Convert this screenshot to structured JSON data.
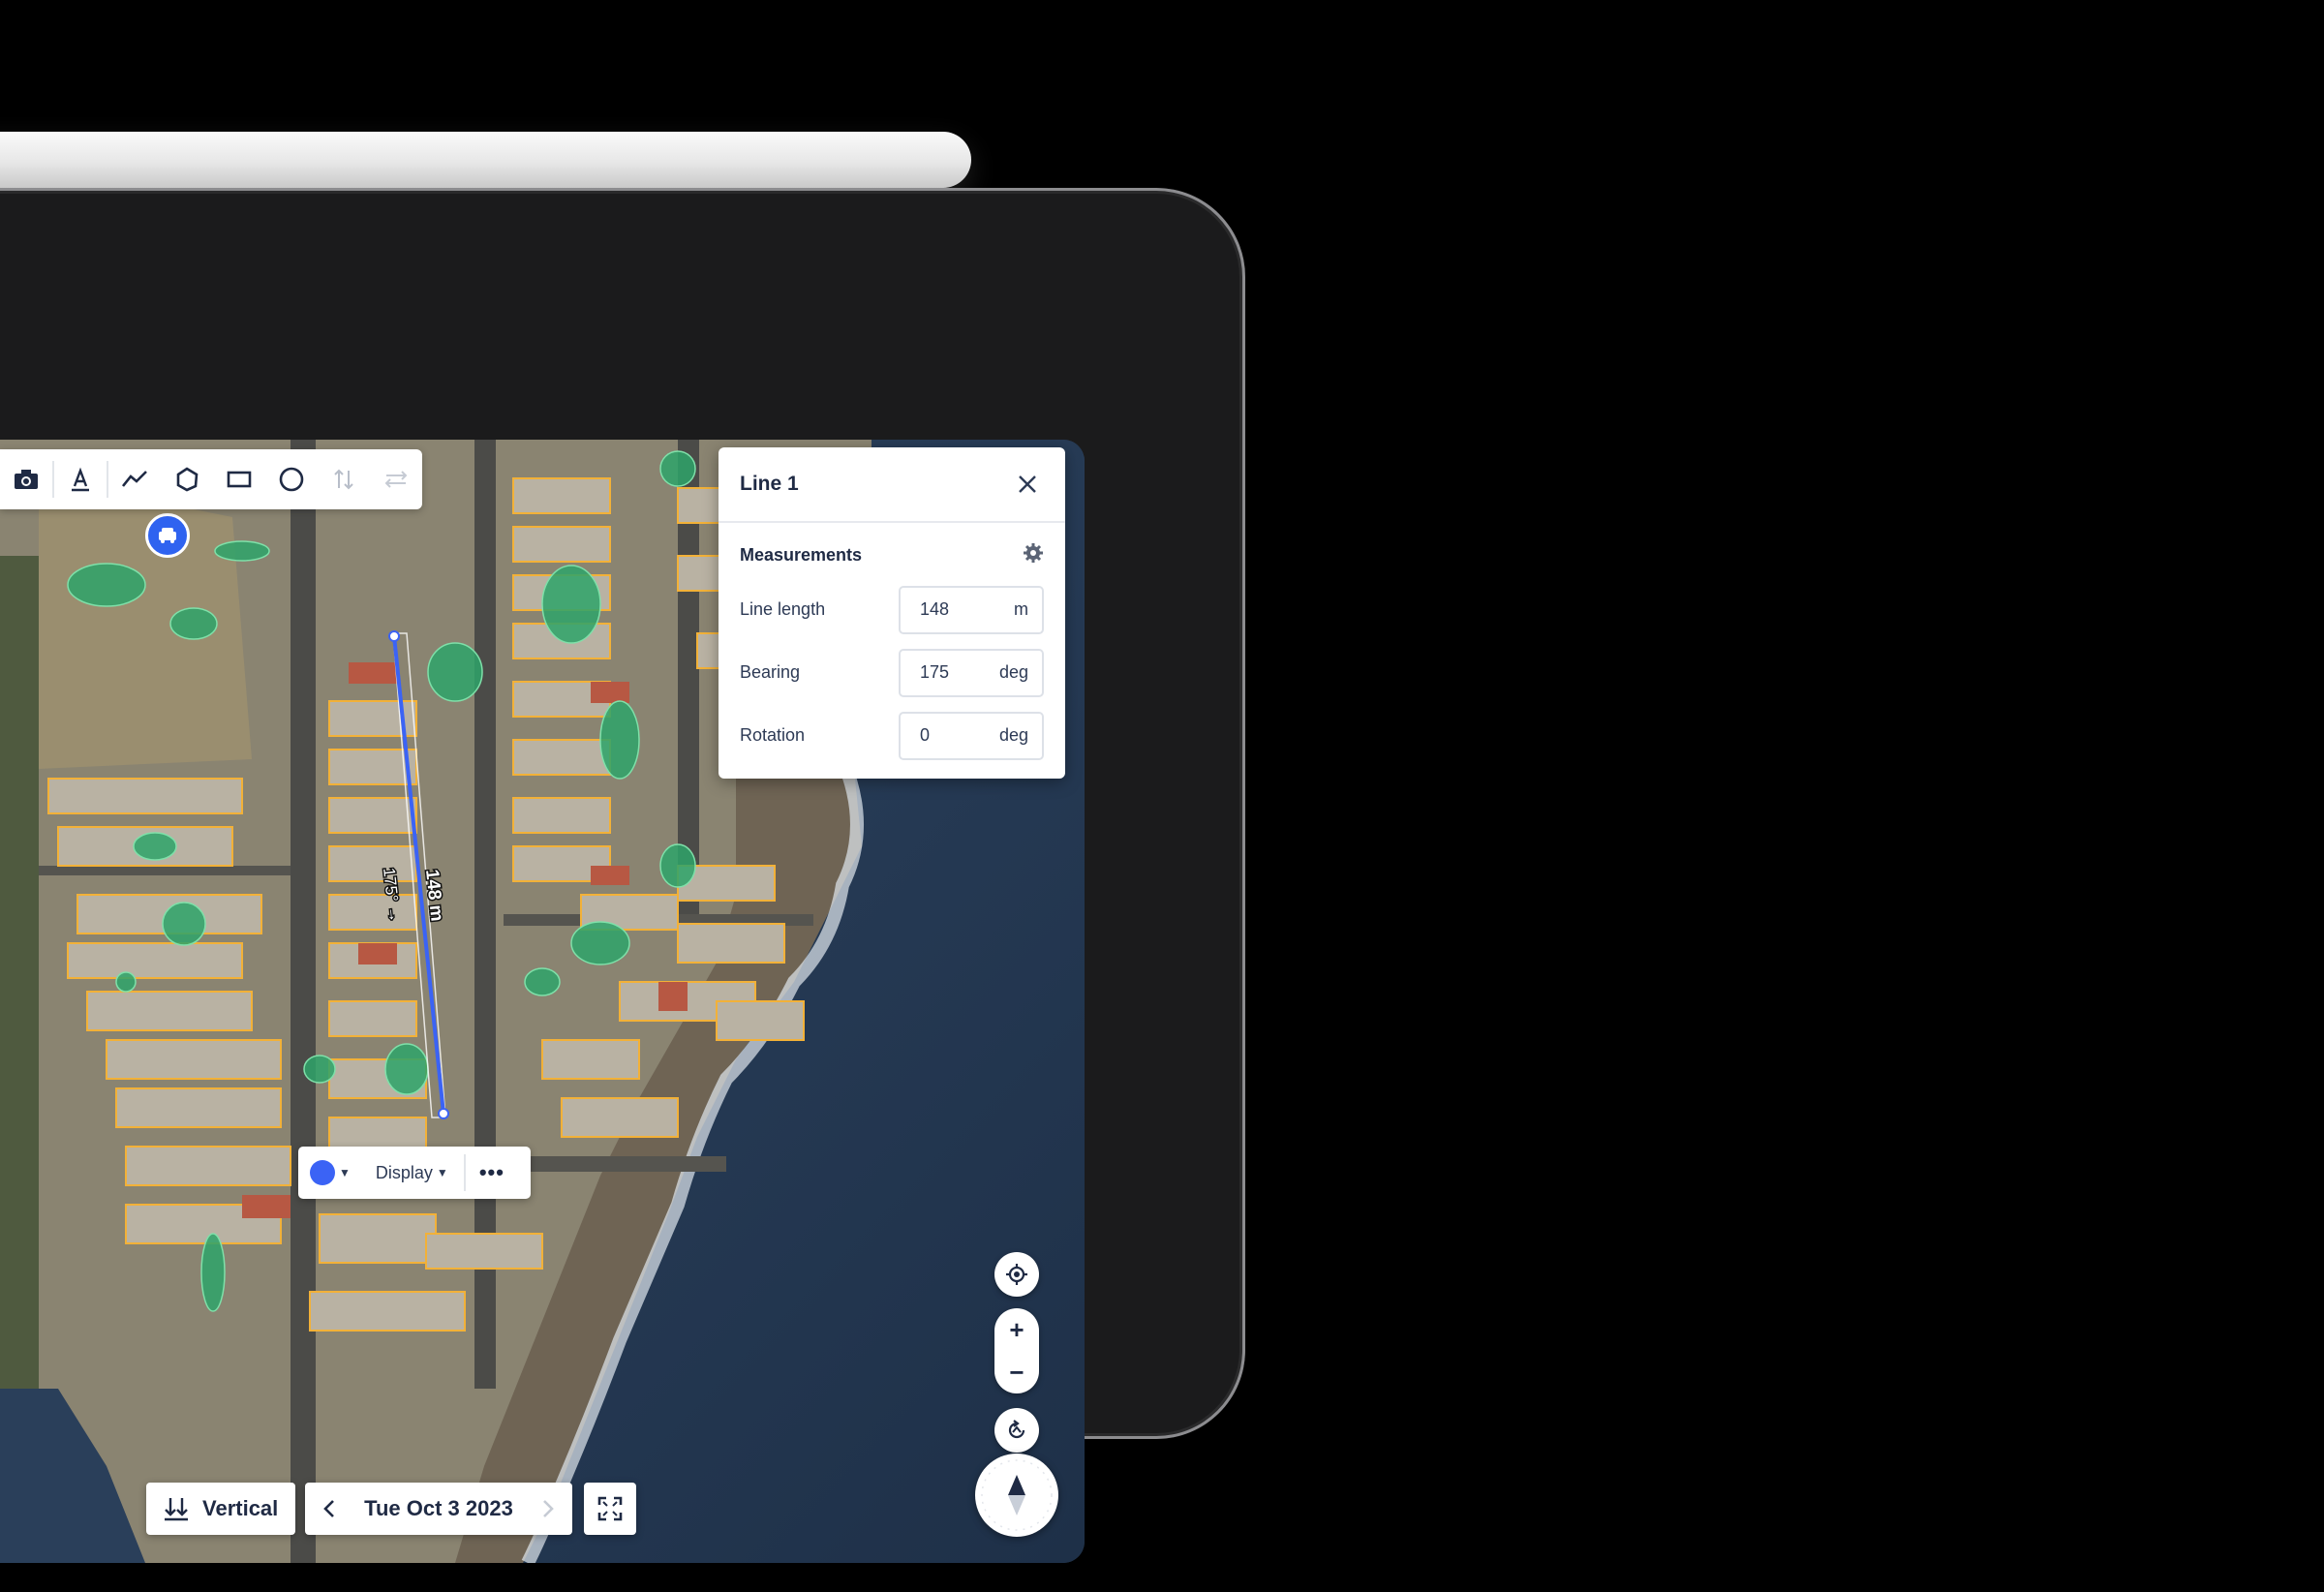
{
  "toolbar": {
    "tools": [
      "camera-icon",
      "text-icon",
      "line-icon",
      "polygon-icon",
      "rectangle-icon",
      "circle-icon",
      "vertical-measure-icon",
      "swap-icon"
    ]
  },
  "panel": {
    "title": "Line 1",
    "section_title": "Measurements",
    "fields": [
      {
        "label": "Line length",
        "value": "148",
        "unit": "m"
      },
      {
        "label": "Bearing",
        "value": "175",
        "unit": "deg"
      },
      {
        "label": "Rotation",
        "value": "0",
        "unit": "deg"
      }
    ]
  },
  "map": {
    "line_length_label": "148 m",
    "bearing_label": "175° →"
  },
  "popup": {
    "color": "#3b63f5",
    "display_label": "Display",
    "more_label": "•••"
  },
  "bottom_bar": {
    "view_label": "Vertical",
    "date_label": "Tue Oct 3 2023"
  },
  "colors": {
    "accent": "#3b63f5",
    "vegetation": "#2ea36a",
    "building_outline": "#f2b138"
  }
}
